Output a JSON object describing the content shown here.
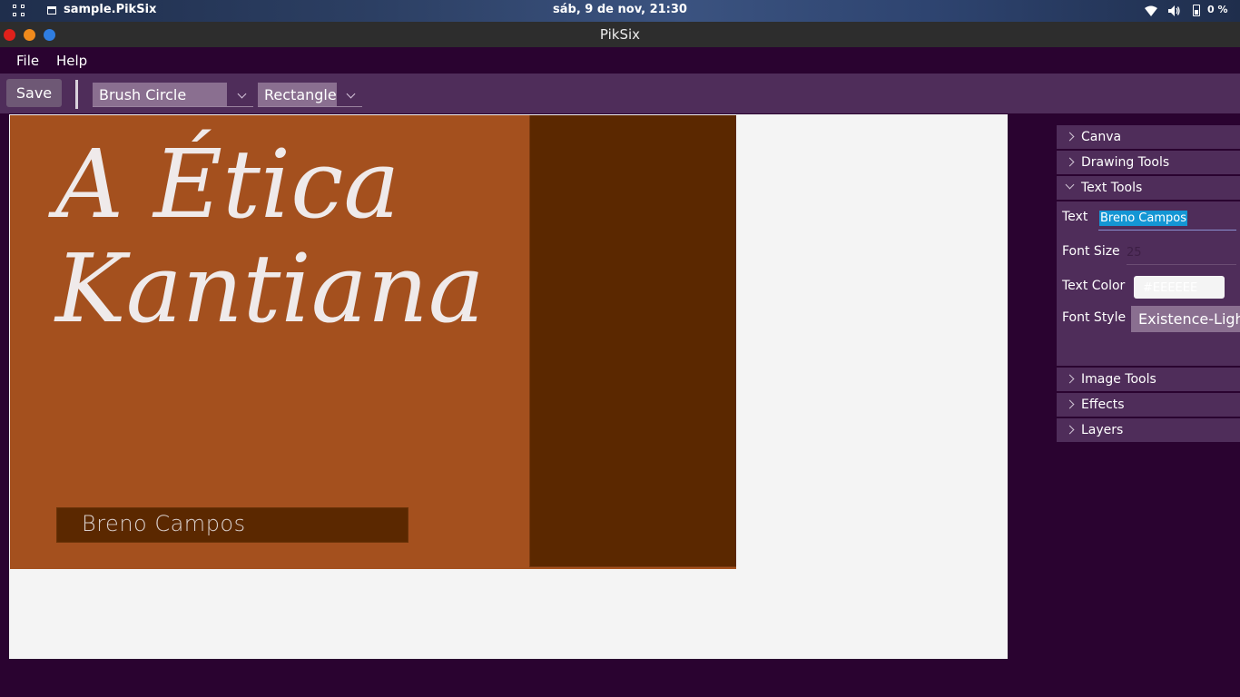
{
  "system_bar": {
    "app_name": "sample.PikSix",
    "clock": "sáb,  9 de nov, 21:30",
    "battery": "0 %"
  },
  "window": {
    "title": "PikSix"
  },
  "menu": {
    "items": [
      "File",
      "Help"
    ]
  },
  "toolbar": {
    "save_label": "Save",
    "brush_select": "Brush Circle",
    "shape_select": "Rectangle"
  },
  "canvas": {
    "title_line1": "A Ética",
    "title_line2": "Kantiana",
    "author": "Breno Campos",
    "colors": {
      "background": "#a4501e",
      "accent_rect": "#5b2800",
      "text": "#efeaea"
    }
  },
  "panel": {
    "sections": {
      "canva": "Canva",
      "drawing_tools": "Drawing Tools",
      "text_tools": "Text Tools",
      "image_tools": "Image Tools",
      "effects": "Effects",
      "layers": "Layers"
    },
    "text_tools": {
      "text_label": "Text",
      "text_value": "Breno Campos",
      "font_size_label": "Font Size",
      "font_size_value": "25",
      "text_color_label": "Text Color",
      "text_color_value": "#EEEEEE",
      "font_style_label": "Font Style",
      "font_style_value": "Existence-Light"
    }
  }
}
